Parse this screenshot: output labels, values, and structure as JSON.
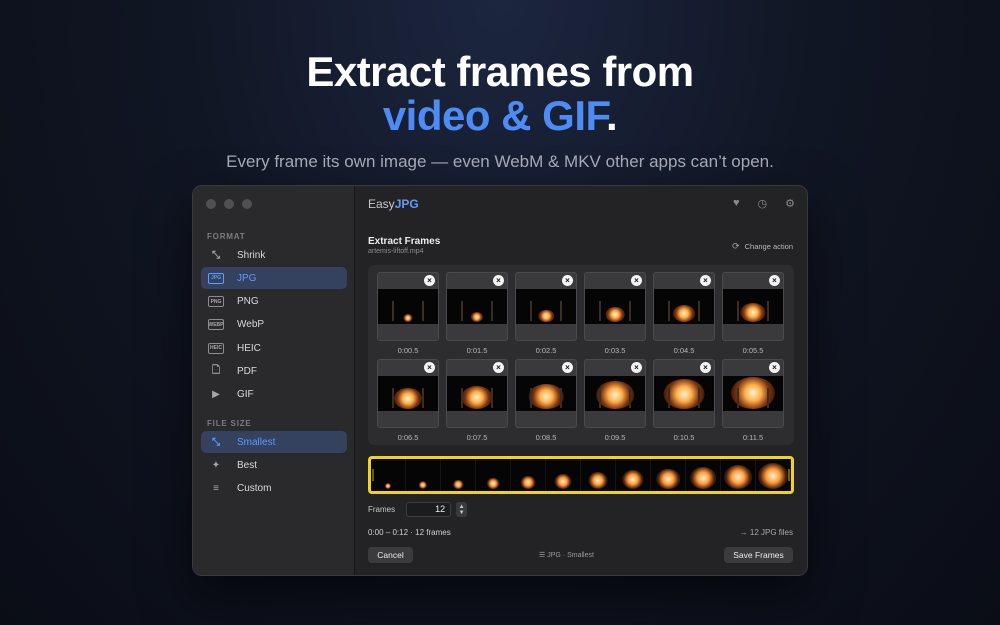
{
  "hero": {
    "title_line1": "Extract frames from",
    "title_accent": "video & GIF",
    "title_period": ".",
    "subtitle": "Every frame its own image — even WebM & MKV other apps can’t open."
  },
  "sidebar": {
    "format_label": "FORMAT",
    "format_items": [
      {
        "label": "Shrink",
        "icon": "shrink-icon",
        "icon_text": "⤡",
        "active": false
      },
      {
        "label": "JPG",
        "icon": "jpg-badge-icon",
        "icon_text": "JPG",
        "active": true
      },
      {
        "label": "PNG",
        "icon": "png-badge-icon",
        "icon_text": "PNG",
        "active": false
      },
      {
        "label": "WebP",
        "icon": "webp-badge-icon",
        "icon_text": "WEBP",
        "active": false
      },
      {
        "label": "HEIC",
        "icon": "heic-badge-icon",
        "icon_text": "HEIC",
        "active": false
      },
      {
        "label": "PDF",
        "icon": "document-icon",
        "icon_text": "🗋",
        "active": false
      },
      {
        "label": "GIF",
        "icon": "play-icon",
        "icon_text": "▶",
        "active": false
      }
    ],
    "size_label": "FILE SIZE",
    "size_items": [
      {
        "label": "Smallest",
        "icon": "compress-icon",
        "icon_text": "⤡",
        "active": true
      },
      {
        "label": "Best",
        "icon": "sparkle-icon",
        "icon_text": "✦",
        "active": false
      },
      {
        "label": "Custom",
        "icon": "sliders-icon",
        "icon_text": "≡",
        "active": false
      }
    ]
  },
  "header": {
    "brand_prefix": "Easy",
    "brand_suffix": "JPG",
    "icons": [
      "heart-icon",
      "history-icon",
      "gear-icon"
    ]
  },
  "main": {
    "title": "Extract Frames",
    "filename": "artemis-liftoff.mp4",
    "change_action": "Change action",
    "frames": [
      {
        "time": "0:00.5"
      },
      {
        "time": "0:01.5"
      },
      {
        "time": "0:02.5"
      },
      {
        "time": "0:03.5"
      },
      {
        "time": "0:04.5"
      },
      {
        "time": "0:05.5"
      },
      {
        "time": "0:06.5"
      },
      {
        "time": "0:07.5"
      },
      {
        "time": "0:08.5"
      },
      {
        "time": "0:09.5"
      },
      {
        "time": "0:10.5"
      },
      {
        "time": "0:11.5"
      }
    ],
    "frames_label": "Frames",
    "frames_value": "12",
    "range": "0:00 – 0:12 · 12 frames",
    "output": "→ 12 JPG files",
    "format_summary": "JPG · Smallest",
    "cancel_label": "Cancel",
    "save_label": "Save Frames",
    "accent_color": "#5f9bff",
    "selection_color": "#f2d318"
  }
}
